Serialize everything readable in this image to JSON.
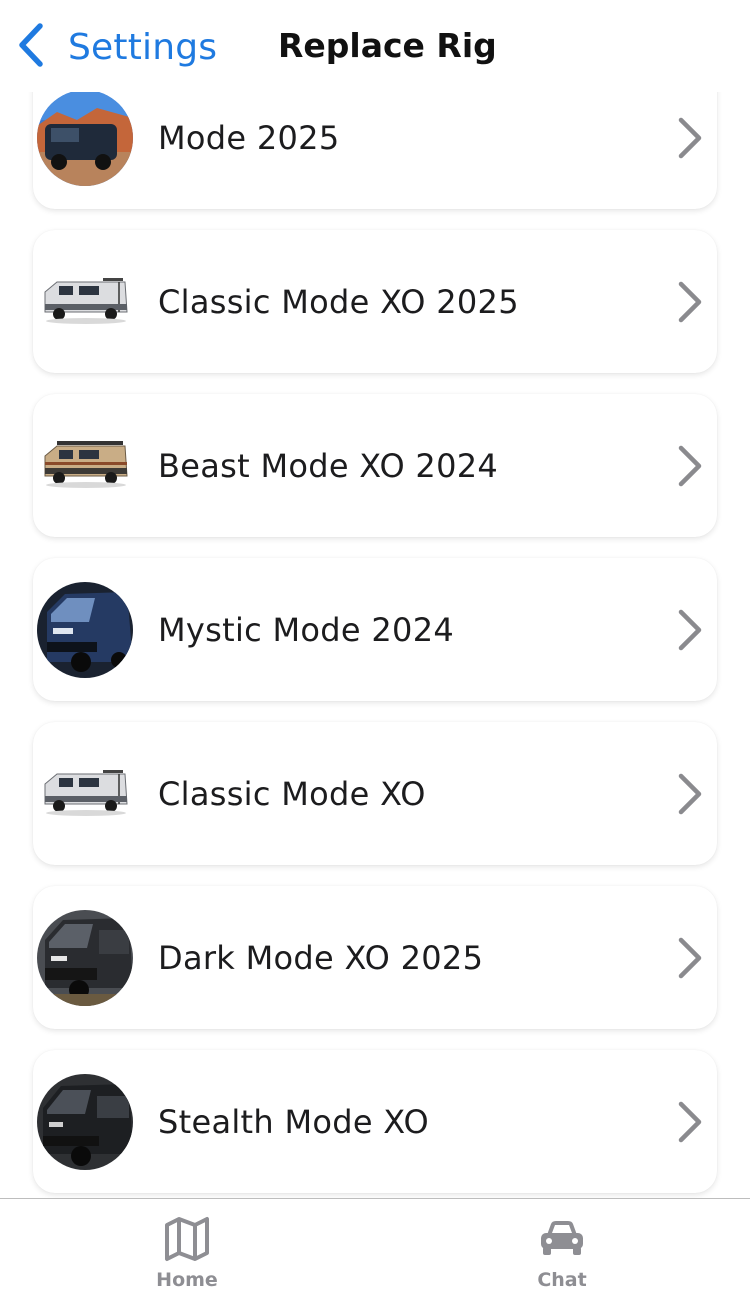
{
  "nav": {
    "back_label": "Settings",
    "title": "Replace Rig"
  },
  "rigs": [
    {
      "label": "Mode 2025",
      "thumb": "photo-van-desert"
    },
    {
      "label": "Classic Mode XO 2025",
      "thumb": "silver-van-side"
    },
    {
      "label": "Beast Mode XO 2024",
      "thumb": "tan-van-side"
    },
    {
      "label": "Mystic Mode 2024",
      "thumb": "photo-van-blue"
    },
    {
      "label": "Classic Mode XO",
      "thumb": "silver-van-side"
    },
    {
      "label": "Dark Mode XO 2025",
      "thumb": "photo-van-dark"
    },
    {
      "label": "Stealth Mode XO",
      "thumb": "photo-van-black"
    }
  ],
  "tabbar": {
    "home_label": "Home",
    "chat_label": "Chat"
  },
  "colors": {
    "accent": "#1f7ae0",
    "tab_inactive": "#8e8e93",
    "chevron": "#8a8a8e"
  }
}
